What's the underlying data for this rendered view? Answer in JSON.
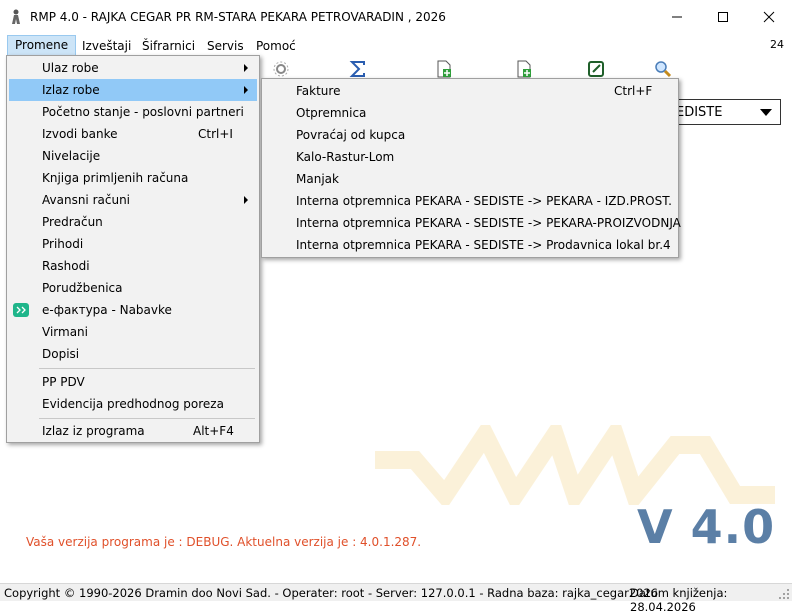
{
  "window": {
    "title": "RMP 4.0 - RAJKA CEGAR PR RM-STARA PEKARA PETROVARADIN , 2026",
    "icon": "app-figure-icon"
  },
  "menubar": {
    "items": [
      {
        "label": "Promene"
      },
      {
        "label": "Izveštaji"
      },
      {
        "label": "Šifrarnici"
      },
      {
        "label": "Servis"
      },
      {
        "label": "Pomoć"
      }
    ],
    "counter": "24"
  },
  "combo": {
    "value": "EDISTE"
  },
  "promene_menu": {
    "items": [
      {
        "label": "Ulaz robe",
        "submenu": true
      },
      {
        "label": "Izlaz robe",
        "submenu": true,
        "highlighted": true
      },
      {
        "label": "Početno stanje - poslovni partneri"
      },
      {
        "label": "Izvodi banke",
        "shortcut": "Ctrl+I"
      },
      {
        "label": "Nivelacije"
      },
      {
        "label": "Knjiga primljenih računa"
      },
      {
        "label": "Avansni računi",
        "submenu": true
      },
      {
        "label": "Predračun"
      },
      {
        "label": "Prihodi"
      },
      {
        "label": "Rashodi"
      },
      {
        "label": "Porudžbenica"
      },
      {
        "label": "е-фактура - Nabavke",
        "icon": "sef-icon"
      },
      {
        "label": "Virmani"
      },
      {
        "label": "Dopisi"
      },
      {
        "label": "PP PDV"
      },
      {
        "label": "Evidencija predhodnog poreza"
      },
      {
        "label": "Izlaz iz programa",
        "shortcut": "Alt+F4"
      }
    ]
  },
  "izlaz_submenu": {
    "items": [
      {
        "label": "Fakture",
        "shortcut": "Ctrl+F"
      },
      {
        "label": "Otpremnica"
      },
      {
        "label": "Povraćaj od kupca"
      },
      {
        "label": "Kalo-Rastur-Lom"
      },
      {
        "label": "Manjak"
      },
      {
        "label": "Interna otpremnica PEKARA - SEDISTE -> PEKARA - IZD.PROST."
      },
      {
        "label": "Interna otpremnica PEKARA - SEDISTE -> PEKARA-PROIZVODNJA"
      },
      {
        "label": "Interna otpremnica PEKARA - SEDISTE -> Prodavnica lokal br.4"
      }
    ]
  },
  "main": {
    "version_big": "V 4.0",
    "debug_text": "Vaša verzija programa je : DEBUG. Aktuelna verzija je : 4.0.1.287."
  },
  "statusbar": {
    "left": "Copyright © 1990-2026 Dramin doo Novi Sad. - Operater: root - Server: 127.0.0.1 - Radna baza: rajka_cegar2026",
    "right": "Datum knjiženja: 28.04.2026"
  },
  "colors": {
    "menu_highlight": "#91c9f7",
    "version_color": "#5b7fa6",
    "debug_color": "#e0502a"
  }
}
